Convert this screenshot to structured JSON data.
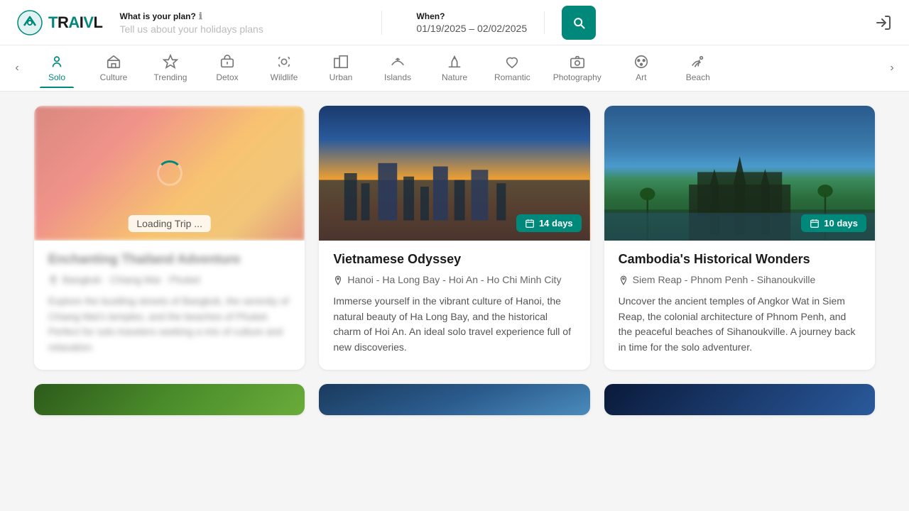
{
  "header": {
    "logo_text": "TRAIVL",
    "plan_label": "What is your plan?",
    "plan_info_icon": "ℹ",
    "plan_placeholder": "Tell us about your holidays plans",
    "date_label": "When?",
    "date_value": "01/19/2025 – 02/02/2025",
    "signin_label": "Sign In"
  },
  "nav": {
    "prev_arrow": "‹",
    "next_arrow": "›",
    "items": [
      {
        "id": "solo",
        "label": "Solo",
        "active": true
      },
      {
        "id": "culture",
        "label": "Culture",
        "active": false
      },
      {
        "id": "trending",
        "label": "Trending",
        "active": false
      },
      {
        "id": "detox",
        "label": "Detox",
        "active": false
      },
      {
        "id": "wildlife",
        "label": "Wildlife",
        "active": false
      },
      {
        "id": "urban",
        "label": "Urban",
        "active": false
      },
      {
        "id": "islands",
        "label": "Islands",
        "active": false
      },
      {
        "id": "nature",
        "label": "Nature",
        "active": false
      },
      {
        "id": "romantic",
        "label": "Romantic",
        "active": false
      },
      {
        "id": "photography",
        "label": "Photography",
        "active": false
      },
      {
        "id": "art",
        "label": "Art",
        "active": false
      },
      {
        "id": "beach",
        "label": "Beach",
        "active": false
      }
    ]
  },
  "cards": [
    {
      "id": "card-1",
      "loading": true,
      "loading_text": "Loading Trip ...",
      "title": "Enchanting Thailand Adventure",
      "title_blurred": true,
      "location": "Bangkok · Chiang Mai · Phuket",
      "location_blurred": true,
      "description": "Explore the bustling streets of Bangkok, the serenity of Chiang Mai's temples, and the beaches of Phuket. Perfect for solo travelers seeking a mix of culture and relaxation.",
      "description_blurred": true,
      "days_badge": null,
      "bg_color": "#b85530"
    },
    {
      "id": "card-2",
      "loading": false,
      "title": "Vietnamese Odyssey",
      "title_blurred": false,
      "location": "Hanoi - Ha Long Bay - Hoi An - Ho Chi Minh City",
      "location_blurred": false,
      "description": "Immerse yourself in the vibrant culture of Hanoi, the natural beauty of Ha Long Bay, and the historical charm of Hoi An. An ideal solo travel experience full of new discoveries.",
      "description_blurred": false,
      "days_badge": "14 days",
      "bg_color": "#e8a030"
    },
    {
      "id": "card-3",
      "loading": false,
      "title": "Cambodia's Historical Wonders",
      "title_blurred": false,
      "location": "Siem Reap - Phnom Penh - Sihanoukville",
      "location_blurred": false,
      "description": "Uncover the ancient temples of Angkor Wat in Siem Reap, the colonial architecture of Phnom Penh, and the peaceful beaches of Sihanoukville. A journey back in time for the solo adventurer.",
      "description_blurred": false,
      "days_badge": "10 days",
      "bg_color": "#3a7a5a"
    }
  ],
  "icons": {
    "calendar": "📅",
    "pin": "📍",
    "search": "🔍",
    "signin": "→"
  }
}
